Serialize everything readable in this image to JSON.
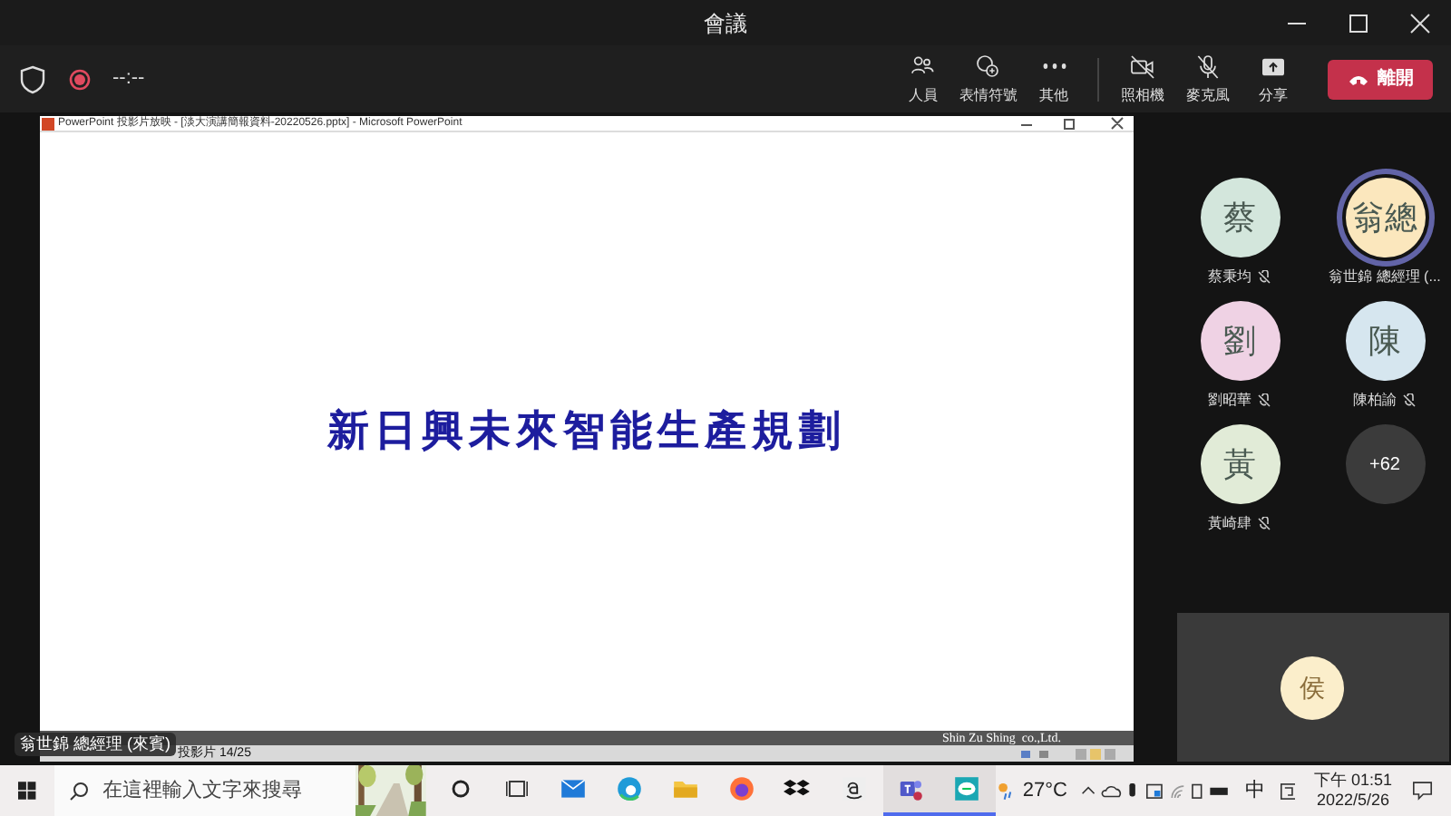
{
  "window": {
    "title": "會議"
  },
  "toolbar": {
    "timer": "--:--",
    "recording": true,
    "buttons": [
      {
        "kind": "people",
        "label": "人員"
      },
      {
        "kind": "reactions",
        "label": "表情符號"
      },
      {
        "kind": "more",
        "label": "其他"
      },
      {
        "kind": "camera_off",
        "label": "照相機"
      },
      {
        "kind": "mic_off",
        "label": "麥克風"
      },
      {
        "kind": "share",
        "label": "分享"
      }
    ],
    "leave_button": "離開"
  },
  "shared_screen": {
    "app_title": "PowerPoint 投影片放映 - [淡大演講簡報資料-20220526.pptx] - Microsoft PowerPoint",
    "slide_title": "新日興未來智能生產規劃",
    "footer": "Shin Zu Shing  co.,Ltd.",
    "status": "投影片 14/25",
    "presenter": "翁世錦 總經理 (來賓)"
  },
  "participants": [
    {
      "initial": "蔡",
      "name": "蔡秉均",
      "color": "#d3e6dc",
      "muted": true,
      "speaking": false
    },
    {
      "initial": "翁總",
      "name": "翁世錦 總經理 (...",
      "color": "#fbe7bd",
      "muted": false,
      "speaking": true
    },
    {
      "initial": "劉",
      "name": "劉昭華",
      "color": "#efd2e4",
      "muted": true,
      "speaking": false
    },
    {
      "initial": "陳",
      "name": "陳柏諭",
      "color": "#d6e6ef",
      "muted": true,
      "speaking": false
    },
    {
      "initial": "黃",
      "name": "黃崎肆",
      "color": "#e1ebd7",
      "muted": true,
      "speaking": false
    }
  ],
  "more_participants": "+62",
  "spotlight": {
    "initial": "侯",
    "color": "#fbeecb"
  },
  "taskbar": {
    "search_placeholder": "在這裡輸入文字來搜尋",
    "apps": [
      {
        "kind": "cortana",
        "active": false
      },
      {
        "kind": "taskview",
        "active": false
      },
      {
        "kind": "mail",
        "active": false
      },
      {
        "kind": "edge",
        "active": false
      },
      {
        "kind": "folder",
        "active": false
      },
      {
        "kind": "firefox",
        "active": false
      },
      {
        "kind": "dropbox",
        "active": false
      },
      {
        "kind": "amazon",
        "active": false
      },
      {
        "kind": "teams",
        "active": true
      },
      {
        "kind": "line",
        "active": true
      }
    ],
    "weather": "27°C",
    "ime": "中",
    "time": "下午 01:51",
    "date": "2022/5/26"
  }
}
